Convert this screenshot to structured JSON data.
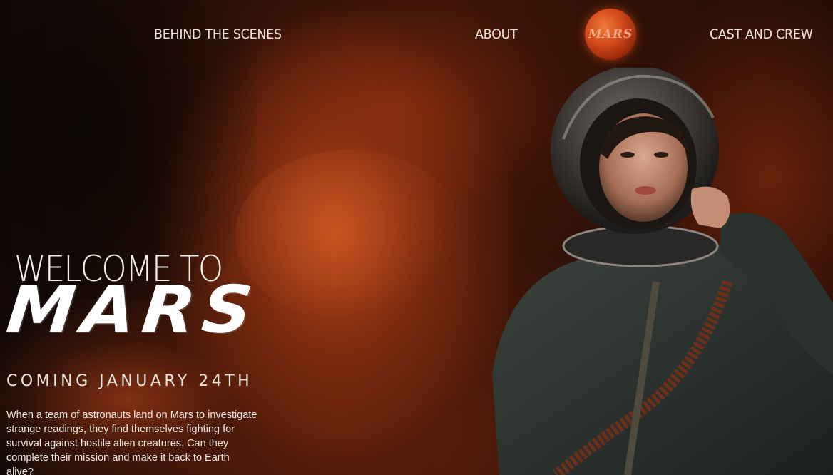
{
  "nav": {
    "behind_the_scenes": "BEHIND THE SCENES",
    "about": "ABOUT",
    "logo_text": "MARS",
    "cast_and_crew": "CAST AND CREW"
  },
  "hero": {
    "welcome": "WELCOME TO",
    "title": "MARS",
    "release": "COMING JANUARY 24TH",
    "synopsis": "When a team of astronauts land on Mars to investigate strange readings, they find themselves fighting for survival against hostile alien creatures. Can they complete their mission and make it back to Earth alive?"
  },
  "colors": {
    "accent": "#d24a1a",
    "text": "#f0e8e2",
    "background": "#2a0f06"
  },
  "icons": {
    "logo": "mars-planet-logo-icon"
  }
}
